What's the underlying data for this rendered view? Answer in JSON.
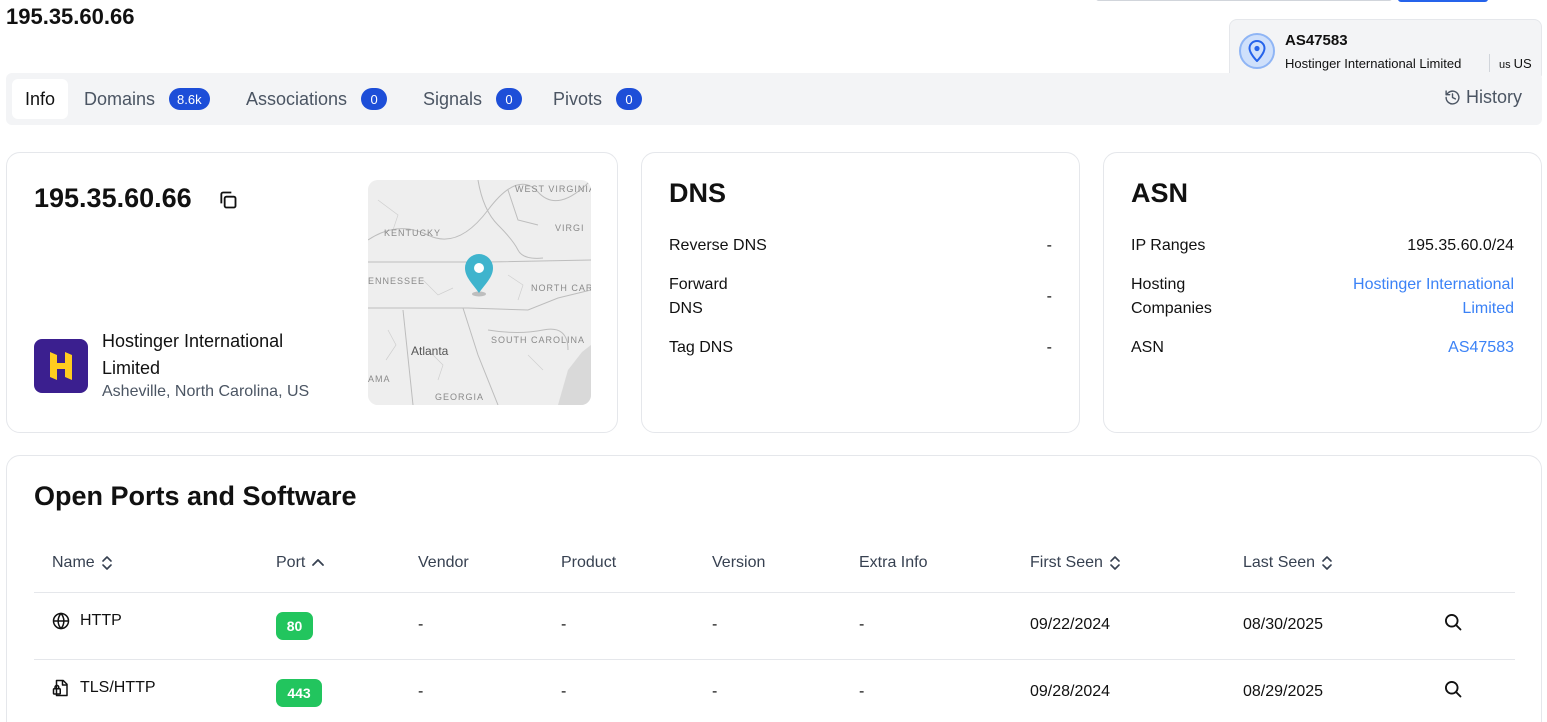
{
  "page": {
    "title": "195.35.60.66"
  },
  "asn_popup": {
    "title": "AS47583",
    "company": "Hostinger International Limited",
    "country_code": "us",
    "country": "US",
    "icon": "location-pin-icon"
  },
  "tabs": [
    {
      "label": "Info",
      "badge": null,
      "active": true
    },
    {
      "label": "Domains",
      "badge": "8.6k"
    },
    {
      "label": "Associations",
      "badge": "0"
    },
    {
      "label": "Signals",
      "badge": "0"
    },
    {
      "label": "Pivots",
      "badge": "0"
    }
  ],
  "history": {
    "label": "History",
    "icon": "history-icon"
  },
  "ip_card": {
    "ip": "195.35.60.66",
    "host_name": "Hostinger International Limited",
    "host_location": "Asheville, North Carolina, US",
    "map_labels": {
      "west_virginia": "WEST VIRGINIA",
      "virginia": "VIRGI",
      "kentucky": "KENTUCKY",
      "tennessee": "ENNESSEE",
      "north_carolina": "NORTH CAROLINA",
      "south_carolina": "SOUTH CAROLINA",
      "atlanta": "Atlanta",
      "georgia": "GEORGIA",
      "alabama": "AMA"
    }
  },
  "dns": {
    "title": "DNS",
    "rows": [
      {
        "label": "Reverse DNS",
        "value": "-"
      },
      {
        "label": "Forward DNS",
        "value": "-"
      },
      {
        "label": "Tag DNS",
        "value": "-"
      }
    ]
  },
  "asn": {
    "title": "ASN",
    "rows": [
      {
        "label": "IP Ranges",
        "value": "195.35.60.0/24"
      },
      {
        "label": "Hosting Companies",
        "value": "Hostinger International Limited"
      },
      {
        "label": "ASN",
        "value": "AS47583"
      }
    ]
  },
  "ports": {
    "title": "Open Ports and Software",
    "columns": [
      "Name",
      "Port",
      "Vendor",
      "Product",
      "Version",
      "Extra Info",
      "First Seen",
      "Last Seen"
    ],
    "rows": [
      {
        "name": "HTTP",
        "icon": "globe-icon",
        "port": "80",
        "vendor": "-",
        "product": "-",
        "version": "-",
        "extra": "-",
        "first_seen": "09/22/2024",
        "last_seen": "08/30/2025"
      },
      {
        "name": "TLS/HTTP",
        "icon": "locked-file-icon",
        "port": "443",
        "vendor": "-",
        "product": "-",
        "version": "-",
        "extra": "-",
        "first_seen": "09/28/2024",
        "last_seen": "08/29/2025"
      }
    ]
  },
  "colors": {
    "accent": "#1d4ed8",
    "link": "#3b82f6",
    "port_badge": "#22c55e"
  }
}
